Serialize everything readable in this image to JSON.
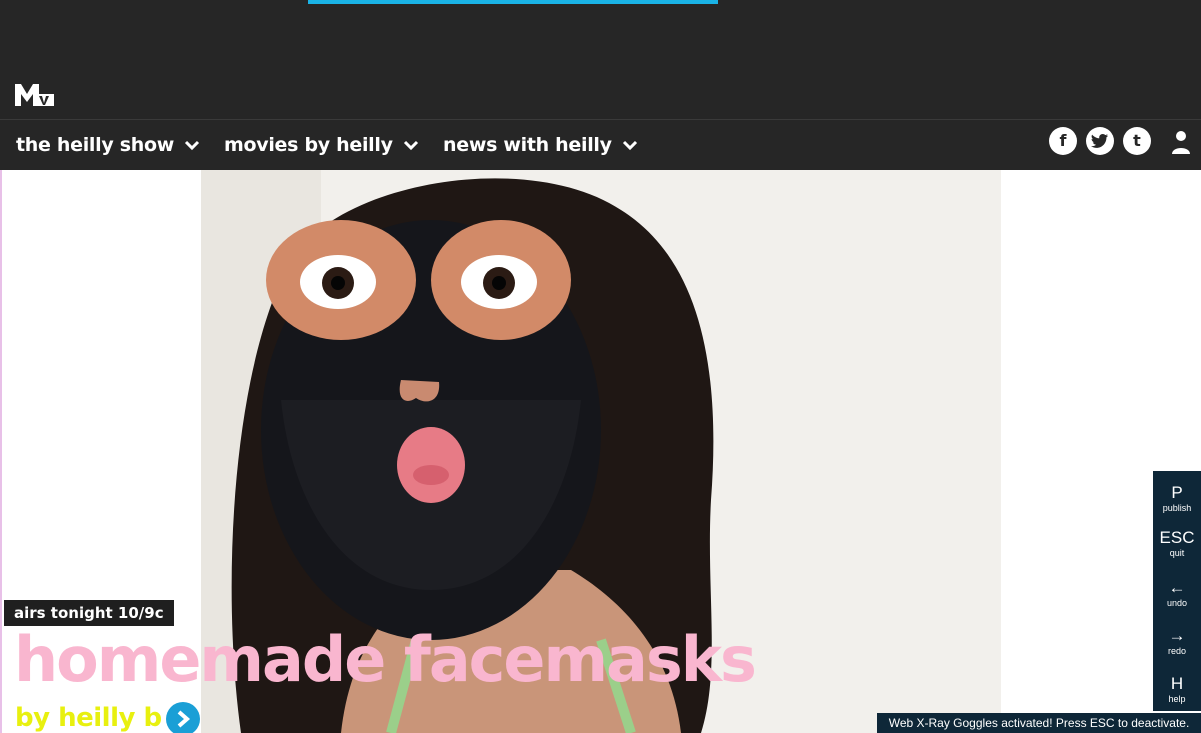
{
  "header": {
    "logo_text": "MTV",
    "colors": {
      "bar": "#262626",
      "progress": "#1ab3e6"
    }
  },
  "nav": {
    "items": [
      {
        "label": "the heilly show"
      },
      {
        "label": "movies by heilly"
      },
      {
        "label": "news with heilly"
      }
    ],
    "social": [
      {
        "icon": "facebook-icon",
        "glyph": "f"
      },
      {
        "icon": "twitter-icon",
        "glyph": "🐦"
      },
      {
        "icon": "tumblr-icon",
        "glyph": "t"
      }
    ],
    "user_icon": "user-icon"
  },
  "feature": {
    "airs": "airs tonight 10/9c",
    "title": "homemade facemasks",
    "byline": "by heilly b",
    "colors": {
      "title": "#f9b6cf",
      "byline": "#e8f00f",
      "arrow": "#1a9fd6"
    }
  },
  "xray": {
    "keys": [
      {
        "key": "P",
        "label": "publish"
      },
      {
        "key": "ESC",
        "label": "quit"
      },
      {
        "key": "←",
        "label": "undo"
      },
      {
        "key": "→",
        "label": "redo"
      },
      {
        "key": "H",
        "label": "help"
      }
    ],
    "status": "Web X-Ray Goggles activated! Press ESC to deactivate."
  }
}
